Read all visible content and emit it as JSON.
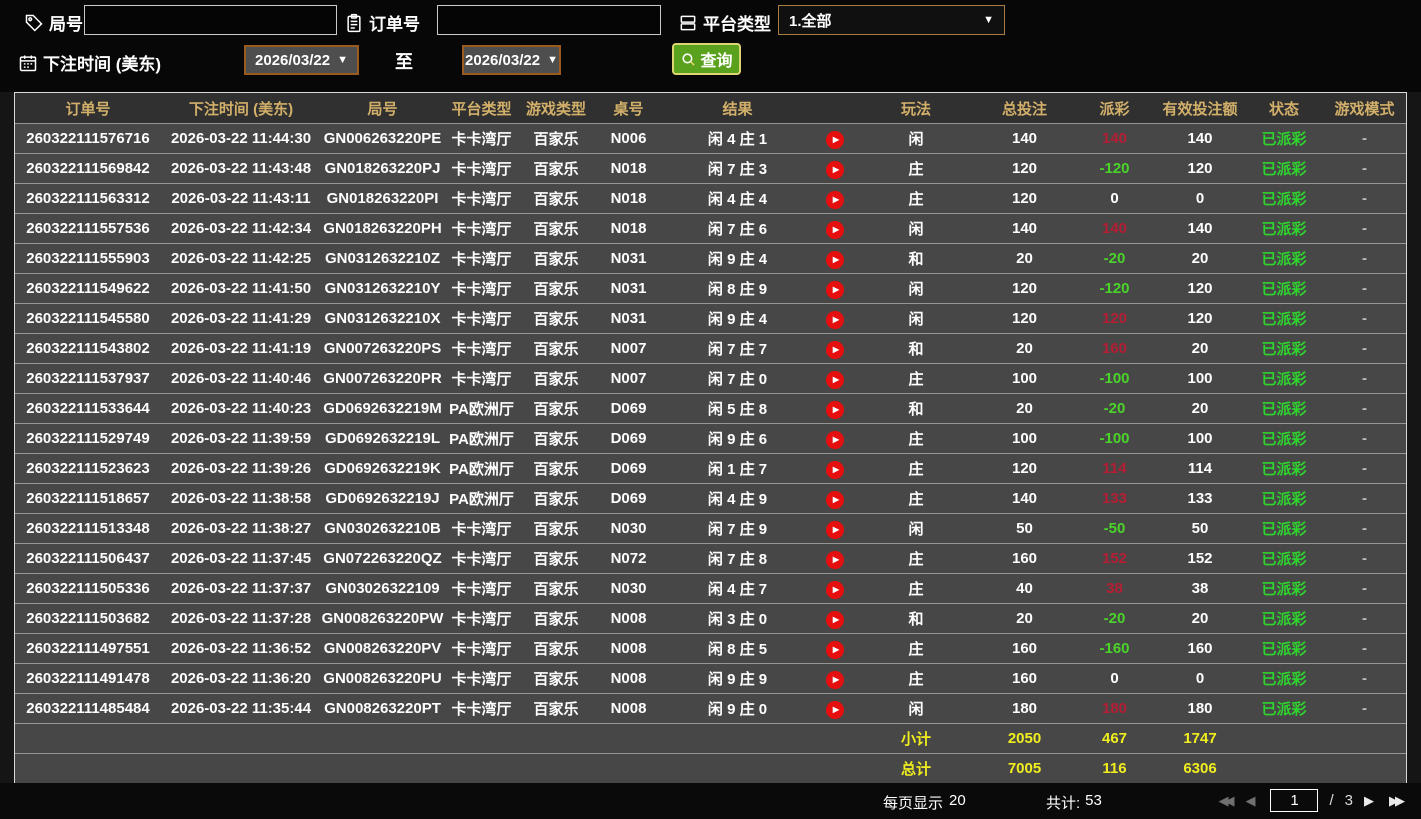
{
  "filters": {
    "round_label": "局号",
    "order_label": "订单号",
    "platform_label": "平台类型",
    "platform_value": "1.全部",
    "bet_time_label": "下注时间 (美东)",
    "date_from": "2026/03/22",
    "date_to": "2026/03/22",
    "to_label": "至",
    "search_label": "查询"
  },
  "colors": {
    "header_gold": "#d2b06a",
    "payout_positive_red": "#b51e35",
    "payout_negative_green": "#4ad42a",
    "status_green": "#2ed32e",
    "totals_yellow": "#f0ee1e",
    "search_button_green": "#5aa11d",
    "date_border_orange": "#9b5a1e"
  },
  "table": {
    "headers": [
      "订单号",
      "下注时间 (美东)",
      "局号",
      "平台类型",
      "游戏类型",
      "桌号",
      "结果",
      "",
      "玩法",
      "总投注",
      "派彩",
      "有效投注额",
      "状态",
      "游戏模式"
    ],
    "rows": [
      {
        "order": "260322111576716",
        "time": "2026-03-22 11:44:30",
        "round": "GN006263220PE",
        "platform": "卡卡湾厅",
        "game": "百家乐",
        "table": "N006",
        "result": "闲 4 庄 1",
        "playtype": "闲",
        "bet": "140",
        "payout": "140",
        "valid": "140",
        "status": "已派彩",
        "mode": "-"
      },
      {
        "order": "260322111569842",
        "time": "2026-03-22 11:43:48",
        "round": "GN018263220PJ",
        "platform": "卡卡湾厅",
        "game": "百家乐",
        "table": "N018",
        "result": "闲 7 庄 3",
        "playtype": "庄",
        "bet": "120",
        "payout": "-120",
        "valid": "120",
        "status": "已派彩",
        "mode": "-"
      },
      {
        "order": "260322111563312",
        "time": "2026-03-22 11:43:11",
        "round": "GN018263220PI",
        "platform": "卡卡湾厅",
        "game": "百家乐",
        "table": "N018",
        "result": "闲 4 庄 4",
        "playtype": "庄",
        "bet": "120",
        "payout": "0",
        "valid": "0",
        "status": "已派彩",
        "mode": "-"
      },
      {
        "order": "260322111557536",
        "time": "2026-03-22 11:42:34",
        "round": "GN018263220PH",
        "platform": "卡卡湾厅",
        "game": "百家乐",
        "table": "N018",
        "result": "闲 7 庄 6",
        "playtype": "闲",
        "bet": "140",
        "payout": "140",
        "valid": "140",
        "status": "已派彩",
        "mode": "-"
      },
      {
        "order": "260322111555903",
        "time": "2026-03-22 11:42:25",
        "round": "GN0312632210Z",
        "platform": "卡卡湾厅",
        "game": "百家乐",
        "table": "N031",
        "result": "闲 9 庄 4",
        "playtype": "和",
        "bet": "20",
        "payout": "-20",
        "valid": "20",
        "status": "已派彩",
        "mode": "-"
      },
      {
        "order": "260322111549622",
        "time": "2026-03-22 11:41:50",
        "round": "GN0312632210Y",
        "platform": "卡卡湾厅",
        "game": "百家乐",
        "table": "N031",
        "result": "闲 8 庄 9",
        "playtype": "闲",
        "bet": "120",
        "payout": "-120",
        "valid": "120",
        "status": "已派彩",
        "mode": "-"
      },
      {
        "order": "260322111545580",
        "time": "2026-03-22 11:41:29",
        "round": "GN0312632210X",
        "platform": "卡卡湾厅",
        "game": "百家乐",
        "table": "N031",
        "result": "闲 9 庄 4",
        "playtype": "闲",
        "bet": "120",
        "payout": "120",
        "valid": "120",
        "status": "已派彩",
        "mode": "-"
      },
      {
        "order": "260322111543802",
        "time": "2026-03-22 11:41:19",
        "round": "GN007263220PS",
        "platform": "卡卡湾厅",
        "game": "百家乐",
        "table": "N007",
        "result": "闲 7 庄 7",
        "playtype": "和",
        "bet": "20",
        "payout": "160",
        "valid": "20",
        "status": "已派彩",
        "mode": "-"
      },
      {
        "order": "260322111537937",
        "time": "2026-03-22 11:40:46",
        "round": "GN007263220PR",
        "platform": "卡卡湾厅",
        "game": "百家乐",
        "table": "N007",
        "result": "闲 7 庄 0",
        "playtype": "庄",
        "bet": "100",
        "payout": "-100",
        "valid": "100",
        "status": "已派彩",
        "mode": "-"
      },
      {
        "order": "260322111533644",
        "time": "2026-03-22 11:40:23",
        "round": "GD0692632219M",
        "platform": "PA欧洲厅",
        "game": "百家乐",
        "table": "D069",
        "result": "闲 5 庄 8",
        "playtype": "和",
        "bet": "20",
        "payout": "-20",
        "valid": "20",
        "status": "已派彩",
        "mode": "-"
      },
      {
        "order": "260322111529749",
        "time": "2026-03-22 11:39:59",
        "round": "GD0692632219L",
        "platform": "PA欧洲厅",
        "game": "百家乐",
        "table": "D069",
        "result": "闲 9 庄 6",
        "playtype": "庄",
        "bet": "100",
        "payout": "-100",
        "valid": "100",
        "status": "已派彩",
        "mode": "-"
      },
      {
        "order": "260322111523623",
        "time": "2026-03-22 11:39:26",
        "round": "GD0692632219K",
        "platform": "PA欧洲厅",
        "game": "百家乐",
        "table": "D069",
        "result": "闲 1 庄 7",
        "playtype": "庄",
        "bet": "120",
        "payout": "114",
        "valid": "114",
        "status": "已派彩",
        "mode": "-"
      },
      {
        "order": "260322111518657",
        "time": "2026-03-22 11:38:58",
        "round": "GD0692632219J",
        "platform": "PA欧洲厅",
        "game": "百家乐",
        "table": "D069",
        "result": "闲 4 庄 9",
        "playtype": "庄",
        "bet": "140",
        "payout": "133",
        "valid": "133",
        "status": "已派彩",
        "mode": "-"
      },
      {
        "order": "260322111513348",
        "time": "2026-03-22 11:38:27",
        "round": "GN0302632210B",
        "platform": "卡卡湾厅",
        "game": "百家乐",
        "table": "N030",
        "result": "闲 7 庄 9",
        "playtype": "闲",
        "bet": "50",
        "payout": "-50",
        "valid": "50",
        "status": "已派彩",
        "mode": "-"
      },
      {
        "order": "260322111506437",
        "time": "2026-03-22 11:37:45",
        "round": "GN072263220QZ",
        "platform": "卡卡湾厅",
        "game": "百家乐",
        "table": "N072",
        "result": "闲 7 庄 8",
        "playtype": "庄",
        "bet": "160",
        "payout": "152",
        "valid": "152",
        "status": "已派彩",
        "mode": "-"
      },
      {
        "order": "260322111505336",
        "time": "2026-03-22 11:37:37",
        "round": "GN03026322109",
        "platform": "卡卡湾厅",
        "game": "百家乐",
        "table": "N030",
        "result": "闲 4 庄 7",
        "playtype": "庄",
        "bet": "40",
        "payout": "38",
        "valid": "38",
        "status": "已派彩",
        "mode": "-"
      },
      {
        "order": "260322111503682",
        "time": "2026-03-22 11:37:28",
        "round": "GN008263220PW",
        "platform": "卡卡湾厅",
        "game": "百家乐",
        "table": "N008",
        "result": "闲 3 庄 0",
        "playtype": "和",
        "bet": "20",
        "payout": "-20",
        "valid": "20",
        "status": "已派彩",
        "mode": "-"
      },
      {
        "order": "260322111497551",
        "time": "2026-03-22 11:36:52",
        "round": "GN008263220PV",
        "platform": "卡卡湾厅",
        "game": "百家乐",
        "table": "N008",
        "result": "闲 8 庄 5",
        "playtype": "庄",
        "bet": "160",
        "payout": "-160",
        "valid": "160",
        "status": "已派彩",
        "mode": "-"
      },
      {
        "order": "260322111491478",
        "time": "2026-03-22 11:36:20",
        "round": "GN008263220PU",
        "platform": "卡卡湾厅",
        "game": "百家乐",
        "table": "N008",
        "result": "闲 9 庄 9",
        "playtype": "庄",
        "bet": "160",
        "payout": "0",
        "valid": "0",
        "status": "已派彩",
        "mode": "-"
      },
      {
        "order": "260322111485484",
        "time": "2026-03-22 11:35:44",
        "round": "GN008263220PT",
        "platform": "卡卡湾厅",
        "game": "百家乐",
        "table": "N008",
        "result": "闲 9 庄 0",
        "playtype": "闲",
        "bet": "180",
        "payout": "180",
        "valid": "180",
        "status": "已派彩",
        "mode": "-"
      }
    ],
    "subtotal": {
      "label": "小计",
      "bet": "2050",
      "payout": "467",
      "valid": "1747"
    },
    "total": {
      "label": "总计",
      "bet": "7005",
      "payout": "116",
      "valid": "6306"
    }
  },
  "pagination": {
    "per_page_label": "每页显示",
    "per_page_value": "20",
    "total_label": "共计:",
    "total_value": "53",
    "current_page": "1",
    "page_separator": "/",
    "total_pages": "3"
  }
}
